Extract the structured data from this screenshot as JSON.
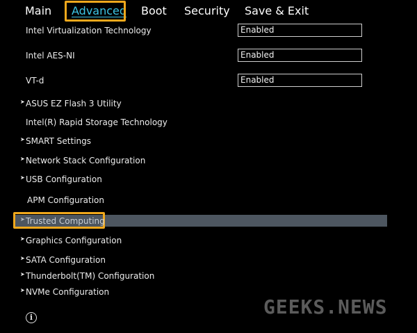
{
  "tabs": [
    {
      "label": "Main"
    },
    {
      "label": "Advanced"
    },
    {
      "label": "Boot"
    },
    {
      "label": "Security"
    },
    {
      "label": "Save & Exit"
    }
  ],
  "settings": [
    {
      "label": "Intel Virtualization Technology",
      "value": "Enabled"
    },
    {
      "label": "Intel AES-NI",
      "value": "Enabled"
    },
    {
      "label": "VT-d",
      "value": "Enabled"
    }
  ],
  "submenus": [
    {
      "label": "ASUS EZ Flash 3 Utility"
    },
    {
      "label": "Intel(R) Rapid Storage Technology"
    },
    {
      "label": "SMART Settings"
    },
    {
      "label": "Network Stack Configuration"
    },
    {
      "label": "USB Configuration"
    },
    {
      "label": "APM Configuration"
    },
    {
      "label": "Trusted Computing"
    },
    {
      "label": "Graphics Configuration"
    },
    {
      "label": "SATA Configuration"
    },
    {
      "label": "Thunderbolt(TM) Configuration"
    },
    {
      "label": "NVMe Configuration"
    }
  ],
  "arrow_glyph": "➤",
  "footer": {
    "info_glyph": "i"
  },
  "watermark": "GEEKS.NEWS",
  "colors": {
    "accent_tab": "#3ec6e6",
    "highlight_border": "#f0a81c",
    "selection_bar": "#4d5660"
  }
}
